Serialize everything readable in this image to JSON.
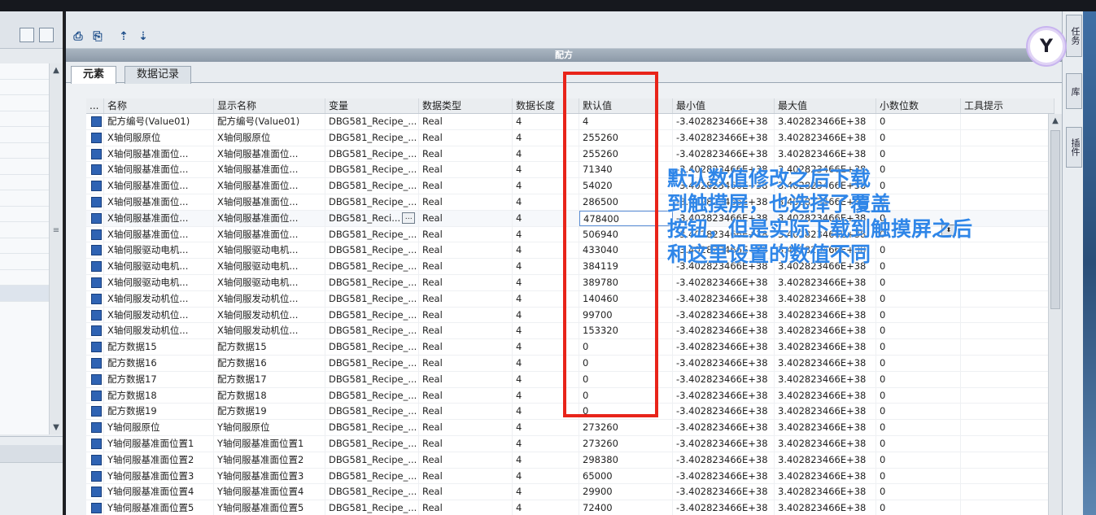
{
  "app": {
    "panel_title": "配方"
  },
  "tabs": [
    {
      "label": "元素"
    },
    {
      "label": "数据记录"
    }
  ],
  "columns": [
    "...",
    "名称",
    "显示名称",
    "变量",
    "数据类型",
    "数据长度",
    "默认值",
    "最小值",
    "最大值",
    "小数位数",
    "工具提示"
  ],
  "rows": [
    {
      "name": "配方编号(Value01)",
      "display": "配方编号(Value01)",
      "var": "DBG581_Recipe_...",
      "type": "Real",
      "len": "4",
      "def": "4",
      "min": "-3.402823466E+38",
      "max": "3.402823466E+38",
      "dec": "0"
    },
    {
      "name": "X轴伺服原位",
      "display": "X轴伺服原位",
      "var": "DBG581_Recipe_...",
      "type": "Real",
      "len": "4",
      "def": "255260",
      "min": "-3.402823466E+38",
      "max": "3.402823466E+38",
      "dec": "0"
    },
    {
      "name": "X轴伺服基准面位...",
      "display": "X轴伺服基准面位...",
      "var": "DBG581_Recipe_...",
      "type": "Real",
      "len": "4",
      "def": "255260",
      "min": "-3.402823466E+38",
      "max": "3.402823466E+38",
      "dec": "0"
    },
    {
      "name": "X轴伺服基准面位...",
      "display": "X轴伺服基准面位...",
      "var": "DBG581_Recipe_...",
      "type": "Real",
      "len": "4",
      "def": "71340",
      "min": "-3.402823466E+38",
      "max": "3.402823466E+38",
      "dec": "0"
    },
    {
      "name": "X轴伺服基准面位...",
      "display": "X轴伺服基准面位...",
      "var": "DBG581_Recipe_...",
      "type": "Real",
      "len": "4",
      "def": "54020",
      "min": "-3.402823466E+38",
      "max": "3.402823466E+38",
      "dec": "0"
    },
    {
      "name": "X轴伺服基准面位...",
      "display": "X轴伺服基准面位...",
      "var": "DBG581_Recipe_...",
      "type": "Real",
      "len": "4",
      "def": "286500",
      "min": "-3.402823466E+38",
      "max": "3.402823466E+38",
      "dec": "0"
    },
    {
      "name": "X轴伺服基准面位...",
      "display": "X轴伺服基准面位...",
      "var": "DBG581_Reci...",
      "type": "Real",
      "len": "4",
      "def": "478400",
      "min": "-3.402823466E+38",
      "max": "3.402823466E+38",
      "dec": "0"
    },
    {
      "name": "X轴伺服基准面位...",
      "display": "X轴伺服基准面位...",
      "var": "DBG581_Recipe_...",
      "type": "Real",
      "len": "4",
      "def": "506940",
      "min": "-3.402823466E+38",
      "max": "3.402823466E+38",
      "dec": "0"
    },
    {
      "name": "X轴伺服驱动电机...",
      "display": "X轴伺服驱动电机...",
      "var": "DBG581_Recipe_...",
      "type": "Real",
      "len": "4",
      "def": "433040",
      "min": "-3.402823466E+38",
      "max": "3.402823466E+38",
      "dec": "0"
    },
    {
      "name": "X轴伺服驱动电机...",
      "display": "X轴伺服驱动电机...",
      "var": "DBG581_Recipe_...",
      "type": "Real",
      "len": "4",
      "def": "384119",
      "min": "-3.402823466E+38",
      "max": "3.402823466E+38",
      "dec": "0"
    },
    {
      "name": "X轴伺服驱动电机...",
      "display": "X轴伺服驱动电机...",
      "var": "DBG581_Recipe_...",
      "type": "Real",
      "len": "4",
      "def": "389780",
      "min": "-3.402823466E+38",
      "max": "3.402823466E+38",
      "dec": "0"
    },
    {
      "name": "X轴伺服发动机位...",
      "display": "X轴伺服发动机位...",
      "var": "DBG581_Recipe_...",
      "type": "Real",
      "len": "4",
      "def": "140460",
      "min": "-3.402823466E+38",
      "max": "3.402823466E+38",
      "dec": "0"
    },
    {
      "name": "X轴伺服发动机位...",
      "display": "X轴伺服发动机位...",
      "var": "DBG581_Recipe_...",
      "type": "Real",
      "len": "4",
      "def": "99700",
      "min": "-3.402823466E+38",
      "max": "3.402823466E+38",
      "dec": "0"
    },
    {
      "name": "X轴伺服发动机位...",
      "display": "X轴伺服发动机位...",
      "var": "DBG581_Recipe_...",
      "type": "Real",
      "len": "4",
      "def": "153320",
      "min": "-3.402823466E+38",
      "max": "3.402823466E+38",
      "dec": "0"
    },
    {
      "name": "配方数据15",
      "display": "配方数据15",
      "var": "DBG581_Recipe_...",
      "type": "Real",
      "len": "4",
      "def": "0",
      "min": "-3.402823466E+38",
      "max": "3.402823466E+38",
      "dec": "0"
    },
    {
      "name": "配方数据16",
      "display": "配方数据16",
      "var": "DBG581_Recipe_...",
      "type": "Real",
      "len": "4",
      "def": "0",
      "min": "-3.402823466E+38",
      "max": "3.402823466E+38",
      "dec": "0"
    },
    {
      "name": "配方数据17",
      "display": "配方数据17",
      "var": "DBG581_Recipe_...",
      "type": "Real",
      "len": "4",
      "def": "0",
      "min": "-3.402823466E+38",
      "max": "3.402823466E+38",
      "dec": "0"
    },
    {
      "name": "配方数据18",
      "display": "配方数据18",
      "var": "DBG581_Recipe_...",
      "type": "Real",
      "len": "4",
      "def": "0",
      "min": "-3.402823466E+38",
      "max": "3.402823466E+38",
      "dec": "0"
    },
    {
      "name": "配方数据19",
      "display": "配方数据19",
      "var": "DBG581_Recipe_...",
      "type": "Real",
      "len": "4",
      "def": "0",
      "min": "-3.402823466E+38",
      "max": "3.402823466E+38",
      "dec": "0"
    },
    {
      "name": "Y轴伺服原位",
      "display": "Y轴伺服原位",
      "var": "DBG581_Recipe_...",
      "type": "Real",
      "len": "4",
      "def": "273260",
      "min": "-3.402823466E+38",
      "max": "3.402823466E+38",
      "dec": "0"
    },
    {
      "name": "Y轴伺服基准面位置1",
      "display": "Y轴伺服基准面位置1",
      "var": "DBG581_Recipe_...",
      "type": "Real",
      "len": "4",
      "def": "273260",
      "min": "-3.402823466E+38",
      "max": "3.402823466E+38",
      "dec": "0"
    },
    {
      "name": "Y轴伺服基准面位置2",
      "display": "Y轴伺服基准面位置2",
      "var": "DBG581_Recipe_...",
      "type": "Real",
      "len": "4",
      "def": "298380",
      "min": "-3.402823466E+38",
      "max": "3.402823466E+38",
      "dec": "0"
    },
    {
      "name": "Y轴伺服基准面位置3",
      "display": "Y轴伺服基准面位置3",
      "var": "DBG581_Recipe_...",
      "type": "Real",
      "len": "4",
      "def": "65000",
      "min": "-3.402823466E+38",
      "max": "3.402823466E+38",
      "dec": "0"
    },
    {
      "name": "Y轴伺服基准面位置4",
      "display": "Y轴伺服基准面位置4",
      "var": "DBG581_Recipe_...",
      "type": "Real",
      "len": "4",
      "def": "29900",
      "min": "-3.402823466E+38",
      "max": "3.402823466E+38",
      "dec": "0"
    },
    {
      "name": "Y轴伺服基准面位置5",
      "display": "Y轴伺服基准面位置5",
      "var": "DBG581_Recipe_...",
      "type": "Real",
      "len": "4",
      "def": "72400",
      "min": "-3.402823466E+38",
      "max": "3.402823466E+38",
      "dec": "0"
    }
  ],
  "edit_row_index": 6,
  "annotation": [
    "默认数值修改之后下载",
    "到触摸屏，也选择了覆盖",
    "按钮，但是实际下载到触摸屏之后",
    "和这里设置的数值不同"
  ],
  "side_tabs": [
    "任务",
    "库",
    "插件"
  ],
  "colors": {
    "annotation": "#2f86e8",
    "highlight_box": "#e8241a",
    "row_icon": "#2f63b3"
  }
}
